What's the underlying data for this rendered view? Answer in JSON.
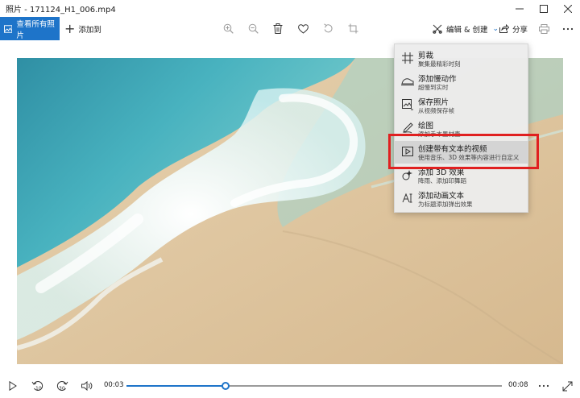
{
  "window": {
    "title": "照片 - 171124_H1_006.mp4",
    "minimize_icon": "minimize-icon",
    "maximize_icon": "maximize-icon",
    "close_icon": "close-icon"
  },
  "toolbar": {
    "view_all_label": "查看所有照片",
    "add_to_label": "添加到",
    "zoom_in_icon": "zoom-in-icon",
    "zoom_out_icon": "zoom-out-icon",
    "delete_icon": "trash-icon",
    "favorite_icon": "heart-icon",
    "rotate_icon": "rotate-icon",
    "crop_icon": "crop-icon",
    "edit_create_label": "编辑 & 创建",
    "share_label": "分享",
    "print_icon": "printer-icon",
    "accent_color": "#1e74c9"
  },
  "menu": {
    "items": [
      {
        "label": "剪裁",
        "desc": "聚集最精彩时刻",
        "icon": "trim-icon"
      },
      {
        "label": "添加慢动作",
        "desc": "超慢到实时",
        "icon": "slow-motion-icon"
      },
      {
        "label": "保存照片",
        "desc": "从视频保存帧",
        "icon": "save-photo-icon"
      },
      {
        "label": "绘图",
        "desc": "添加手本墨材壶",
        "icon": "pen-icon"
      },
      {
        "label": "创建带有文本的视频",
        "desc": "使用音乐、3D 效果等内容进行自定义",
        "icon": "video-text-icon"
      },
      {
        "label": "添加 3D 效果",
        "desc": "降雨、添加印舞蹈",
        "icon": "effects-3d-icon"
      },
      {
        "label": "添加动画文本",
        "desc": "为标题添加弹出效果",
        "icon": "animated-text-icon"
      }
    ],
    "highlighted_index": 4,
    "highlight_color": "#e02020"
  },
  "player": {
    "play_icon": "play-icon",
    "rewind_label": "10",
    "forward_label": "30",
    "volume_icon": "volume-icon",
    "current_time": "00:03",
    "total_time": "00:08",
    "progress_fraction": 0.265,
    "more_icon": "more-icon",
    "fullscreen_icon": "fullscreen-icon"
  }
}
